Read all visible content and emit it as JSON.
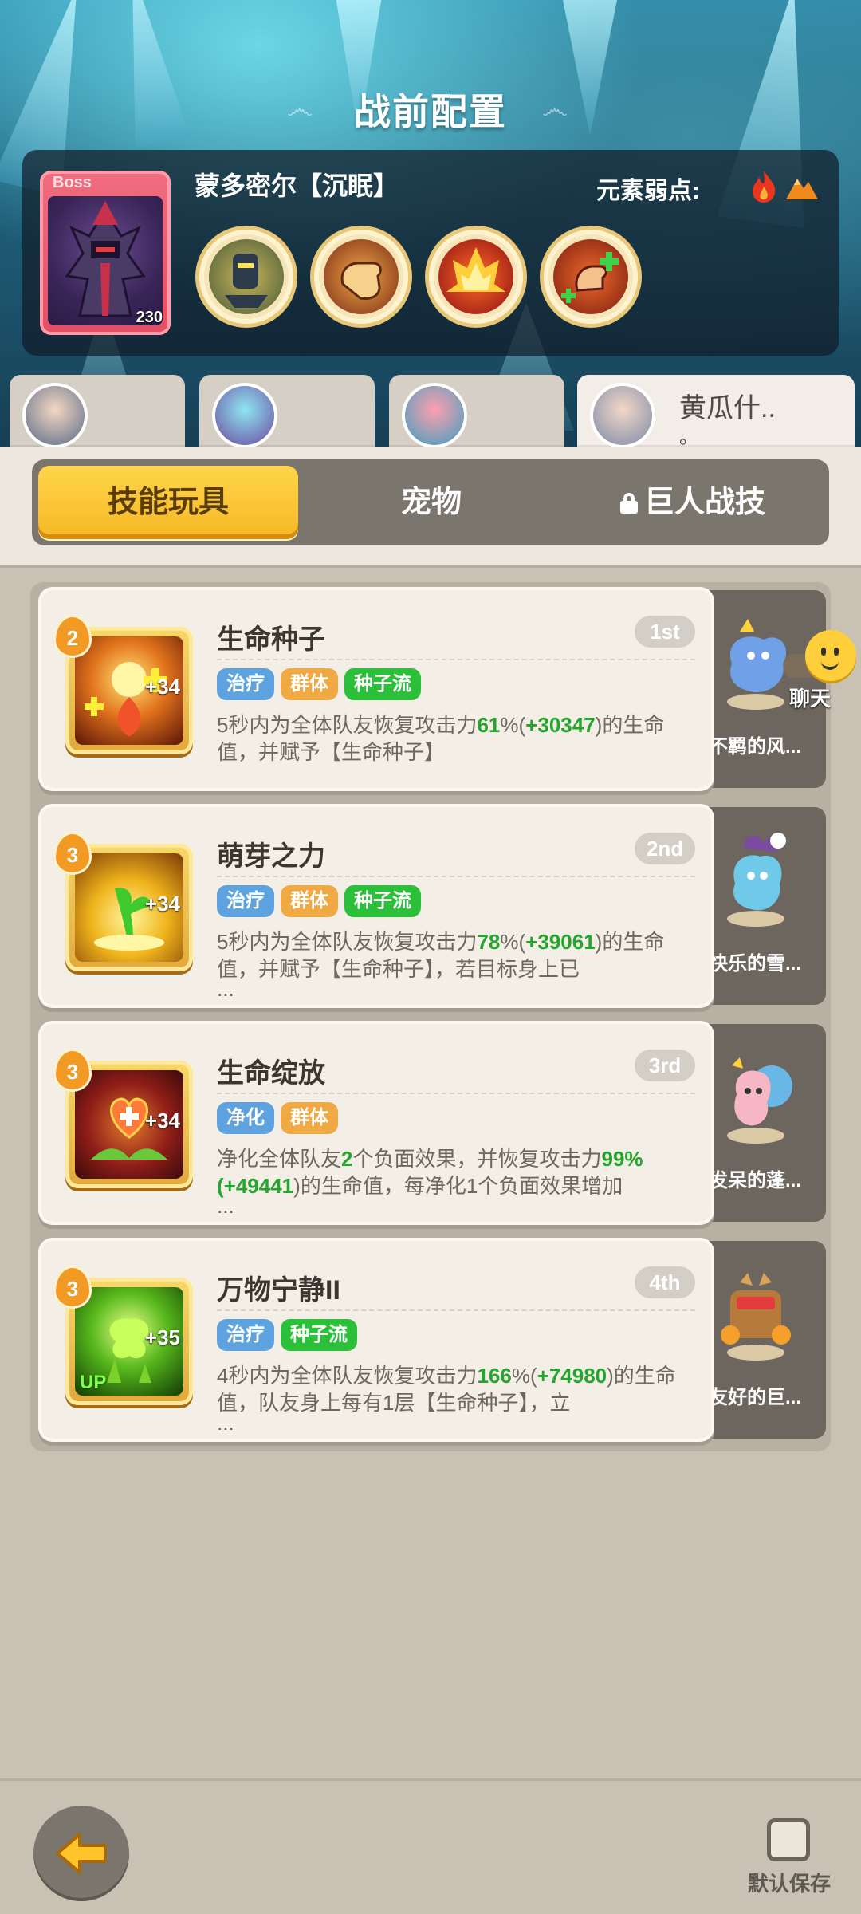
{
  "header": {
    "title": "战前配置"
  },
  "boss": {
    "tag": "Boss",
    "level": "230",
    "name": "蒙多密尔【沉眠】",
    "weakness_label": "元素弱点:",
    "weakness_icons": [
      "fire-icon",
      "mountain-icon"
    ],
    "skills": [
      "figure-skill-icon",
      "fist-skill-icon",
      "flame-skill-icon",
      "heal-hand-skill-icon"
    ]
  },
  "team": [
    {
      "name": ""
    },
    {
      "name": ""
    },
    {
      "name": ""
    },
    {
      "name": "黄瓜什..",
      "sub": "。"
    }
  ],
  "tabs": [
    {
      "label": "技能玩具"
    },
    {
      "label": "宠物"
    },
    {
      "label": "巨人战技"
    }
  ],
  "skills": [
    {
      "level": "2",
      "bonus": "+34",
      "title": "生命种子",
      "rank": "1st",
      "tags": [
        "治疗",
        "群体",
        "种子流"
      ],
      "desc_a": "5秒内为全体队友恢复攻击力",
      "pct": "61",
      "desc_b": "%(",
      "val": "+30347",
      "desc_c": ")的生命值，并赋予【生命种子】",
      "ellipsis": "",
      "pet_name": "不羁的风..."
    },
    {
      "level": "3",
      "bonus": "+34",
      "title": "萌芽之力",
      "rank": "2nd",
      "tags": [
        "治疗",
        "群体",
        "种子流"
      ],
      "desc_a": "5秒内为全体队友恢复攻击力",
      "pct": "78",
      "desc_b": "%(",
      "val": "+39061",
      "desc_c": ")的生命值，并赋予【生命种子】，若目标身上已",
      "ellipsis": "...",
      "pet_name": "快乐的雪..."
    },
    {
      "level": "3",
      "bonus": "+34",
      "title": "生命绽放",
      "rank": "3rd",
      "tags": [
        "净化",
        "群体"
      ],
      "desc_a": "净化全体队友",
      "pct": "2",
      "desc_b": "个负面效果，并恢复攻击力",
      "val": "99%(+49441",
      "desc_c": ")的生命值，每净化1个负面效果增加",
      "ellipsis": "...",
      "pet_name": "发呆的蓬..."
    },
    {
      "level": "3",
      "bonus": "+35",
      "title": "万物宁静II",
      "rank": "4th",
      "tags": [
        "治疗",
        "种子流"
      ],
      "up": "UP",
      "desc_a": "4秒内为全体队友恢复攻击力",
      "pct": "166",
      "desc_b": "%(",
      "val": "+74980",
      "desc_c": ")的生命值，队友身上每有1层【生命种子】，立",
      "ellipsis": "...",
      "pet_name": "友好的巨..."
    }
  ],
  "chat": {
    "label": "聊天"
  },
  "footer": {
    "save_label": "默认保存"
  },
  "colors": {
    "accent": "#f6b825",
    "heal_tag": "#5ea3e0",
    "group_tag": "#f1aa43",
    "seed_tag": "#2bbf3a",
    "boss_frame": "#e54f66"
  }
}
